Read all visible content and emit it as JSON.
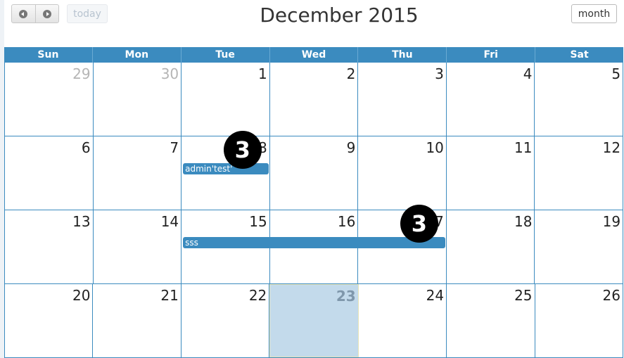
{
  "toolbar": {
    "prev_icon": "prev-icon",
    "next_icon": "next-icon",
    "today_label": "today",
    "title": "December 2015",
    "month_label": "month"
  },
  "calendar": {
    "days_of_week": [
      "Sun",
      "Mon",
      "Tue",
      "Wed",
      "Thu",
      "Fri",
      "Sat"
    ],
    "weeks": [
      [
        "29",
        "30",
        "1",
        "2",
        "3",
        "4",
        "5"
      ],
      [
        "6",
        "7",
        "8",
        "9",
        "10",
        "11",
        "12"
      ],
      [
        "13",
        "14",
        "15",
        "16",
        "17",
        "18",
        "19"
      ],
      [
        "20",
        "21",
        "22",
        "23",
        "24",
        "25",
        "26"
      ]
    ],
    "other_month_days": [
      "29",
      "30"
    ],
    "today": "23",
    "events": [
      {
        "title": "admin'test'",
        "start": "8",
        "end": "8",
        "badge": "3"
      },
      {
        "title": "sss",
        "start": "15",
        "end": "17",
        "badge": "3"
      }
    ],
    "accent_color": "#3b8bbf"
  }
}
